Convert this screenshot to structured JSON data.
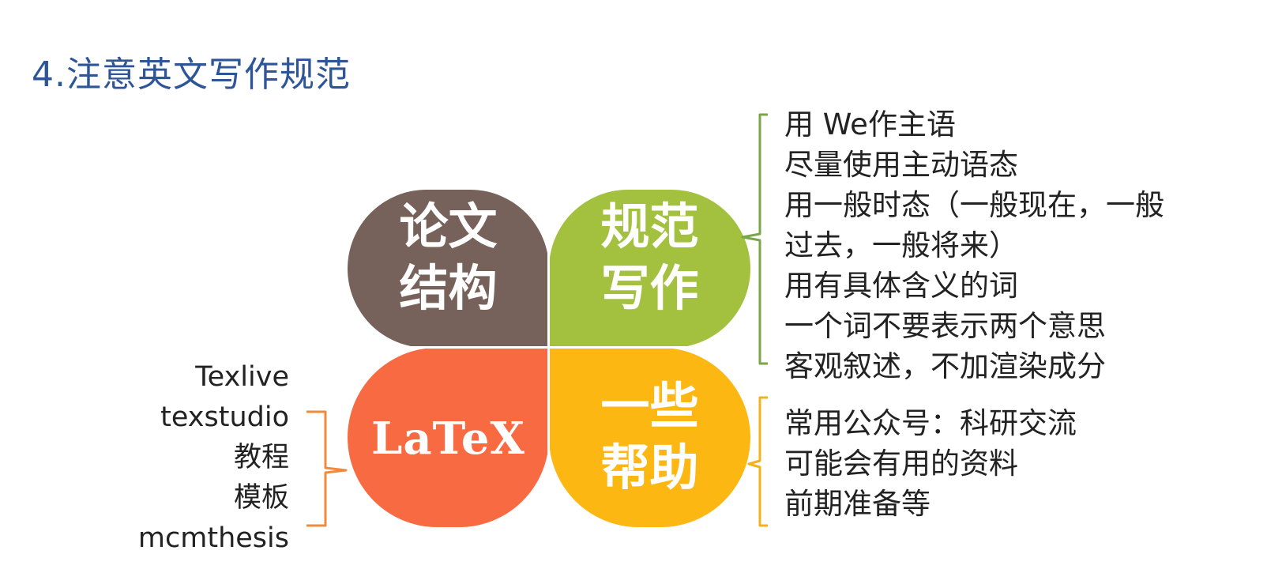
{
  "title": "4.注意英文写作规范",
  "quadrants": {
    "top_left": {
      "lines": [
        "论文",
        "结构"
      ],
      "color": "#76625a"
    },
    "top_right": {
      "lines": [
        "规范",
        "写作"
      ],
      "color": "#a3c13f"
    },
    "bottom_left": {
      "lines": [
        "LaTeX"
      ],
      "color": "#f86b42"
    },
    "bottom_right": {
      "lines": [
        "一些",
        "帮助"
      ],
      "color": "#fdb713"
    }
  },
  "writing_rules": [
    "用 We作主语",
    "尽量使用主动语态",
    "用一般时态（一般现在，一般",
    "过去，一般将来）",
    "用有具体含义的词",
    "一个词不要表示两个意思",
    "客观叙述，不加渲染成分"
  ],
  "help_items": [
    "常用公众号：科研交流",
    "可能会有用的资料",
    "前期准备等"
  ],
  "latex_items": [
    "Texlive",
    "texstudio",
    "教程",
    "模板",
    "mcmthesis"
  ],
  "colors": {
    "title": "#2e5597",
    "brace_green": "#7aa647",
    "brace_orange": "#f08a3c",
    "brace_yellow": "#f2b21b"
  }
}
